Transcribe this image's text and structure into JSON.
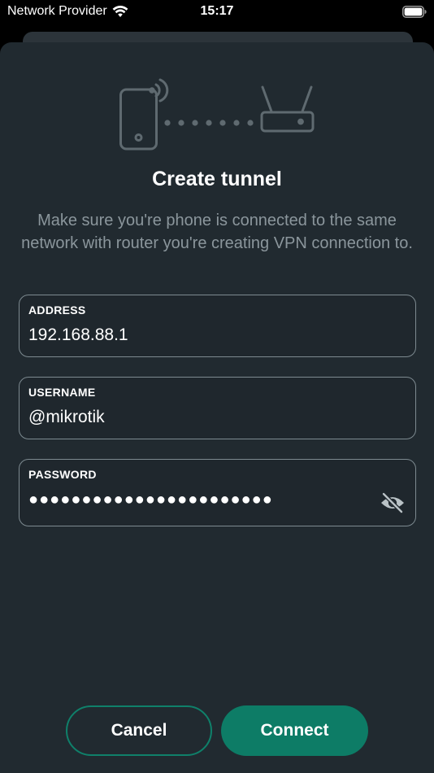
{
  "status_bar": {
    "carrier": "Network Provider",
    "time": "15:17"
  },
  "dialog": {
    "title": "Create tunnel",
    "description": "Make sure you're phone is connected to the same network with router you're creating VPN connection to.",
    "fields": {
      "address": {
        "label": "ADDRESS",
        "value": "192.168.88.1"
      },
      "username": {
        "label": "USERNAME",
        "value": "@mikrotik"
      },
      "password": {
        "label": "PASSWORD",
        "value": "●●●●●●●●●●●●●●●●●●●●●●●"
      }
    },
    "buttons": {
      "cancel": "Cancel",
      "connect": "Connect"
    }
  },
  "icons": {
    "wifi": "wifi-icon",
    "battery": "battery-icon",
    "phone": "phone-icon",
    "router": "router-icon",
    "eye_toggle": "eye-slash-icon"
  },
  "colors": {
    "sheet_background": "#212a30",
    "accent": "#0d7c66",
    "muted_text": "#8b969c",
    "field_border": "#7d8a90"
  }
}
